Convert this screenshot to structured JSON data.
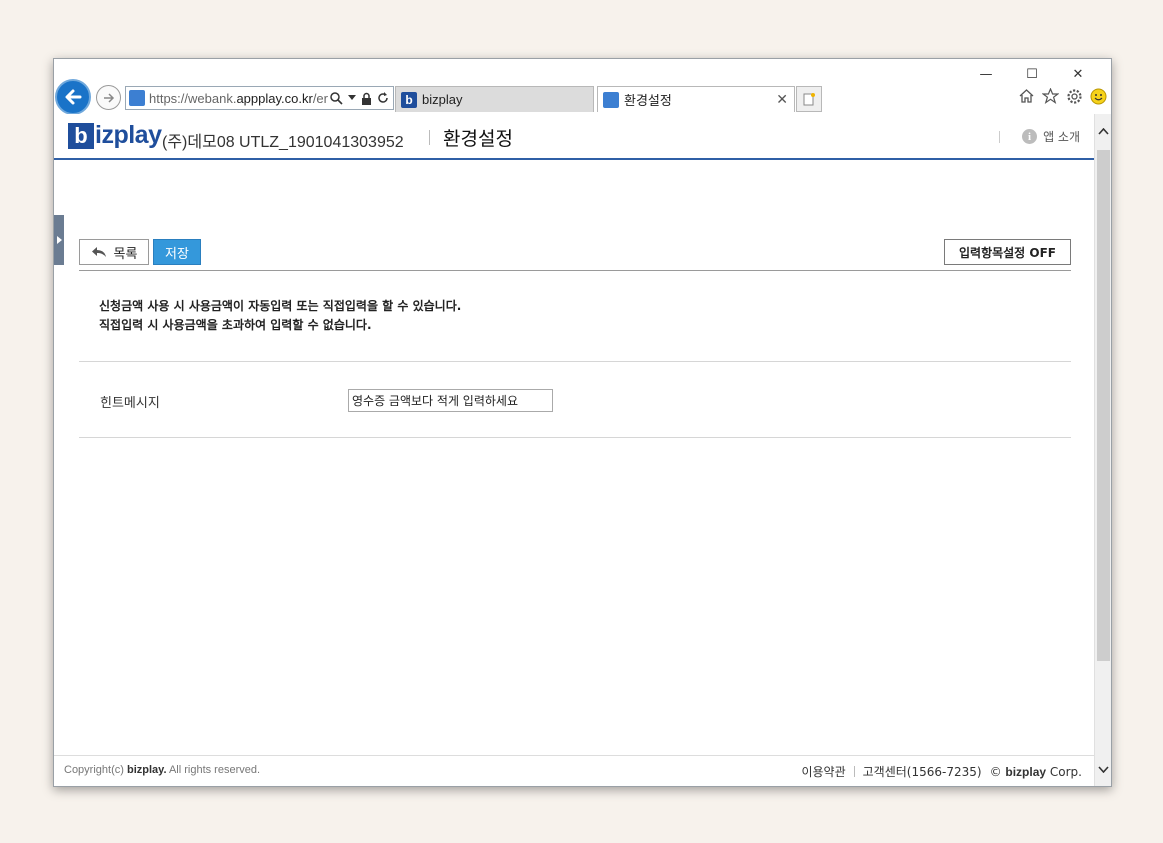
{
  "browser": {
    "url_main": "https://webank.",
    "url_domain": "appplay.co.kr",
    "url_rest": "/er",
    "tabs": [
      {
        "label": "bizplay"
      },
      {
        "label": "환경설정"
      }
    ],
    "window_controls": {
      "minimize": "—",
      "maximize": "☐",
      "close": "✕"
    }
  },
  "header": {
    "logo_b": "b",
    "logo_rest": "izplay",
    "company": "(주)데모08 UTLZ_1901041303952",
    "title": "환경설정",
    "app_intro": "앱 소개"
  },
  "toolbar": {
    "list_label": "목록",
    "save_label": "저장",
    "toggle_label": "입력항목설정 OFF"
  },
  "notice": {
    "line1": "신청금액 사용 시 사용금액이 자동입력 또는 직접입력을 할 수 있습니다.",
    "line2": "직접입력 시 사용금액을 초과하여 입력할 수 없습니다."
  },
  "form": {
    "hint_label": "힌트메시지",
    "hint_value": "영수증 금액보다 적게 입력하세요"
  },
  "footer": {
    "copyright_prefix": "Copyright(c) ",
    "copyright_brand": "bizplay.",
    "copyright_suffix": " All rights reserved.",
    "terms": "이용약관",
    "support": "고객센터(1566-7235)",
    "corp_symbol": "©",
    "corp_brand": "bizplay",
    "corp_suffix": "Corp."
  }
}
